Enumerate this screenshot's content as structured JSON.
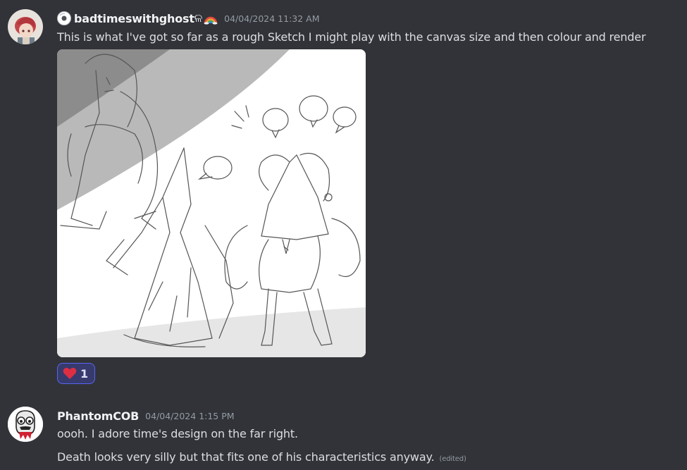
{
  "messages": [
    {
      "username": "badtimeswithghost",
      "username_suffix": "ଳ",
      "timestamp": "04/04/2024 11:32 AM",
      "text": "This is what I've got so far as a rough Sketch I might play with the canvas size and then colour and render",
      "attachment": {
        "kind": "sketch-image"
      },
      "reactions": [
        {
          "emoji": "heart-icon",
          "count": "1",
          "color": "#f23f43"
        }
      ]
    },
    {
      "username": "PhantomCOB",
      "timestamp": "04/04/2024 1:15 PM",
      "lines": [
        "oooh. I adore time's design on the far right.",
        "Death looks very silly but that fits one of his characteristics anyway."
      ],
      "edited_label": "(edited)"
    }
  ],
  "colors": {
    "background": "#313338",
    "text": "#dbdee1",
    "username": "#f2f3f5",
    "muted": "#949ba4",
    "reaction_border": "#5865f2",
    "reaction_bg": "#373a6d"
  }
}
